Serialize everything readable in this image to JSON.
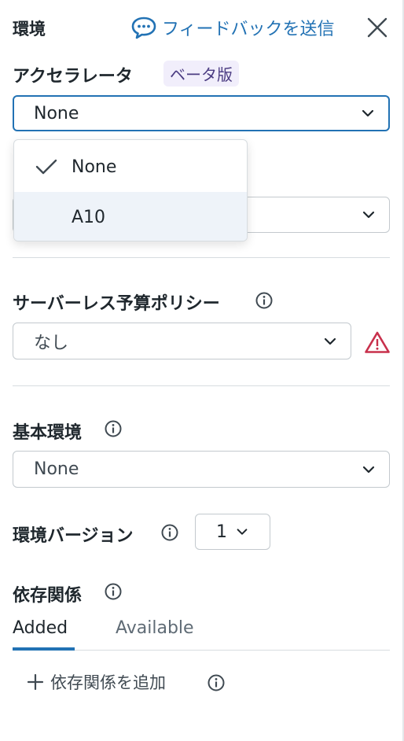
{
  "header": {
    "title": "環境",
    "feedback_label": "フィードバックを送信"
  },
  "accelerator": {
    "label": "アクセラレータ",
    "beta_badge": "ベータ版",
    "selected": "None",
    "options": [
      "None",
      "A10"
    ],
    "checked_index": 0,
    "hovered_index": 1
  },
  "hidden_select": {
    "value": ""
  },
  "budget_policy": {
    "label": "サーバーレス予算ポリシー",
    "selected": "なし"
  },
  "base_environment": {
    "label": "基本環境",
    "selected": "None"
  },
  "environment_version": {
    "label": "環境バージョン",
    "selected": "1"
  },
  "dependencies": {
    "label": "依存関係",
    "tabs": [
      "Added",
      "Available"
    ],
    "active_tab": "Added",
    "add_label": "依存関係を追加"
  },
  "colors": {
    "accent": "#2272b4",
    "warning": "#c8304c",
    "badge_bg": "#f1eefb"
  },
  "icons": [
    "feedback-bubble-icon",
    "close-icon",
    "chevron-down-icon",
    "check-icon",
    "info-icon",
    "warning-icon",
    "plus-icon"
  ]
}
